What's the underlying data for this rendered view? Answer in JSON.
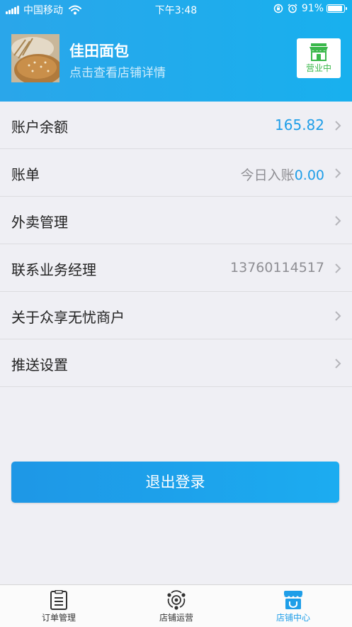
{
  "status": {
    "carrier": "中国移动",
    "time": "下午3:48",
    "battery": "91%",
    "battery_level": 0.91
  },
  "header": {
    "shop_name": "佳田面包",
    "shop_subtitle": "点击查看店铺详情",
    "open_status": "营业中"
  },
  "menu": {
    "balance": {
      "label": "账户余额",
      "value": "165.82"
    },
    "bill": {
      "label": "账单",
      "prefix": "今日入账",
      "amount": "0.00"
    },
    "takeout": {
      "label": "外卖管理"
    },
    "manager": {
      "label": "联系业务经理",
      "value": "13760114517"
    },
    "about": {
      "label": "关于众享无忧商户"
    },
    "push": {
      "label": "推送设置"
    }
  },
  "logout_label": "退出登录",
  "tabs": [
    {
      "label": "订单管理",
      "icon": "order-list-icon"
    },
    {
      "label": "店铺运营",
      "icon": "operation-icon"
    },
    {
      "label": "店铺中心",
      "icon": "store-icon",
      "active": true
    }
  ],
  "colors": {
    "header": "#1aa9ec",
    "accent": "#1f9ee8",
    "open_green": "#3bb84b"
  }
}
